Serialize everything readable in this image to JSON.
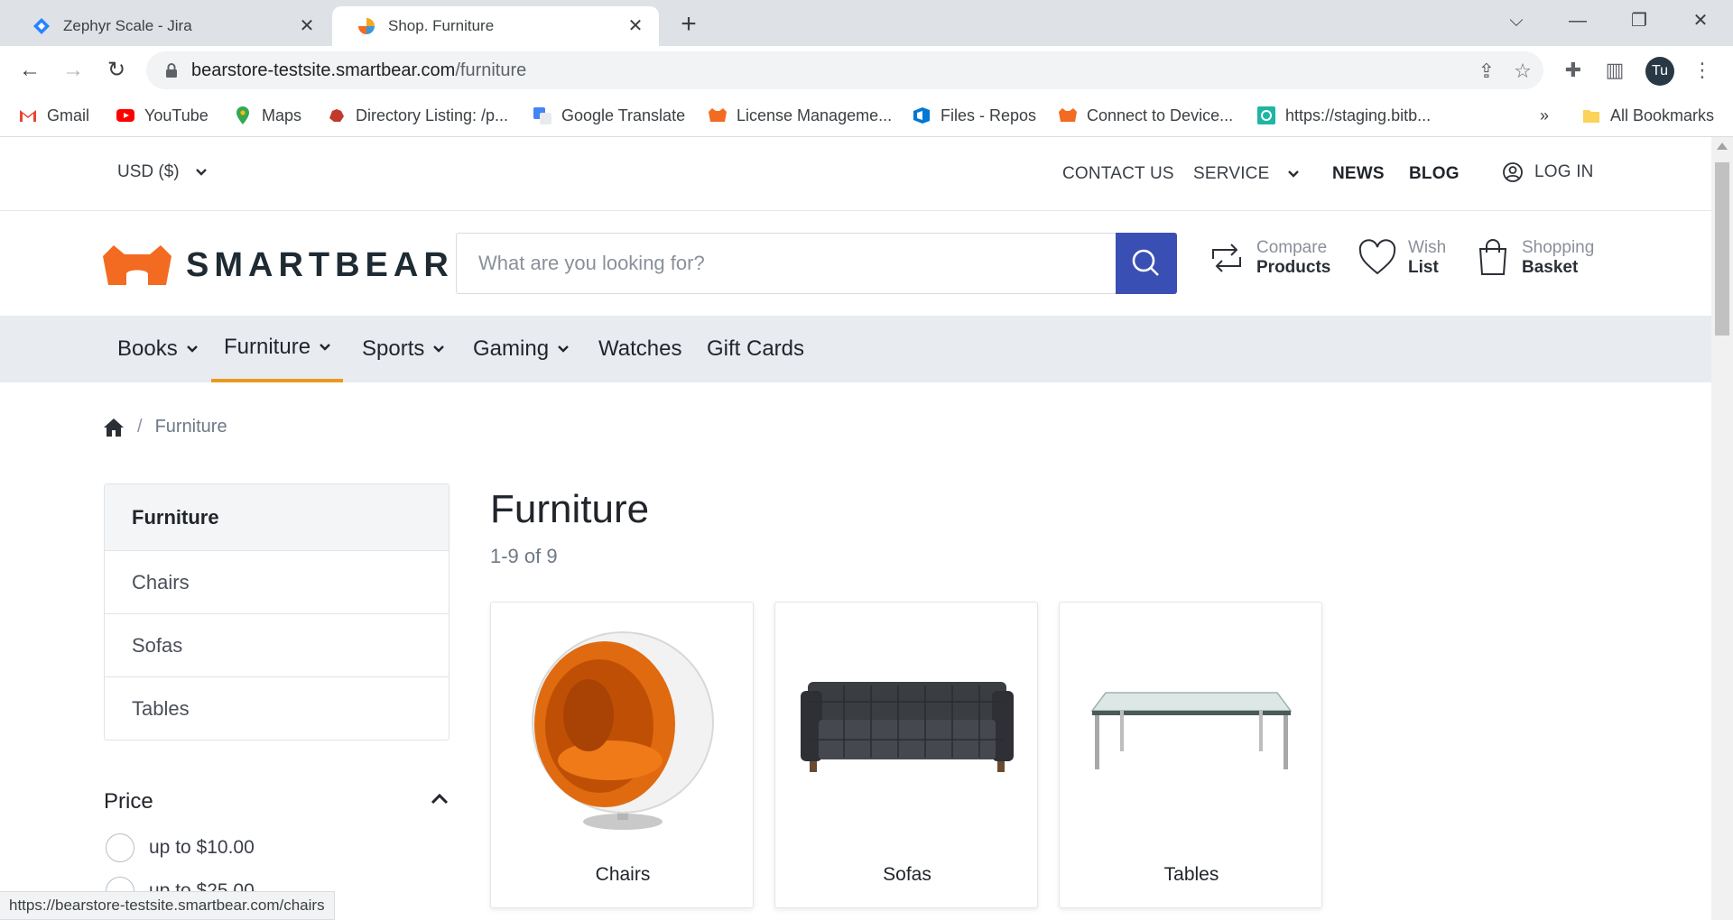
{
  "browser": {
    "tabs": [
      {
        "title": "Zephyr Scale - Jira",
        "icon": "jira-icon"
      },
      {
        "title": "Shop. Furniture",
        "icon": "smartbear-tab-icon"
      }
    ],
    "url_host": "bearstore-testsite.smartbear.com",
    "url_path": "/furniture",
    "profile_initials": "Tu",
    "bookmarks": [
      {
        "label": "Gmail",
        "icon": "gmail-icon"
      },
      {
        "label": "YouTube",
        "icon": "youtube-icon"
      },
      {
        "label": "Maps",
        "icon": "maps-icon"
      },
      {
        "label": "Directory Listing: /p...",
        "icon": "directory-icon"
      },
      {
        "label": "Google Translate",
        "icon": "translate-icon"
      },
      {
        "label": "License Manageme...",
        "icon": "smartbear-icon"
      },
      {
        "label": "Files - Repos",
        "icon": "azure-icon"
      },
      {
        "label": "Connect to Device...",
        "icon": "smartbear-icon"
      },
      {
        "label": "https://staging.bitb...",
        "icon": "bitbar-icon"
      }
    ],
    "bookmarks_overflow": "»",
    "all_bookmarks": "All Bookmarks",
    "status_url": "https://bearstore-testsite.smartbear.com/chairs"
  },
  "topbar": {
    "currency": "USD ($)",
    "links": {
      "contact": "CONTACT US",
      "service": "SERVICE",
      "news": "NEWS",
      "blog": "BLOG",
      "login": "LOG IN"
    }
  },
  "header": {
    "logo_text": "SMARTBEAR",
    "search_placeholder": "What are you looking for?",
    "compare": {
      "line1": "Compare",
      "line2": "Products"
    },
    "wishlist": {
      "line1": "Wish",
      "line2": "List"
    },
    "basket": {
      "line1": "Shopping",
      "line2": "Basket"
    }
  },
  "categories": [
    {
      "label": "Books",
      "has_dropdown": true
    },
    {
      "label": "Furniture",
      "has_dropdown": true,
      "active": true
    },
    {
      "label": "Sports",
      "has_dropdown": true
    },
    {
      "label": "Gaming",
      "has_dropdown": true
    },
    {
      "label": "Watches",
      "has_dropdown": false
    },
    {
      "label": "Gift Cards",
      "has_dropdown": false
    }
  ],
  "breadcrumb": {
    "current": "Furniture"
  },
  "sidebar": {
    "items": [
      "Furniture",
      "Chairs",
      "Sofas",
      "Tables"
    ],
    "filter_title": "Price",
    "price_options": [
      "up to $10.00",
      "up to $25.00"
    ]
  },
  "main": {
    "title": "Furniture",
    "count": "1-9 of 9",
    "products": [
      {
        "label": "Chairs"
      },
      {
        "label": "Sofas"
      },
      {
        "label": "Tables"
      }
    ]
  },
  "colors": {
    "accent_orange": "#e89a20",
    "search_button": "#3a4fb4",
    "logo_orange": "#f26b21"
  }
}
